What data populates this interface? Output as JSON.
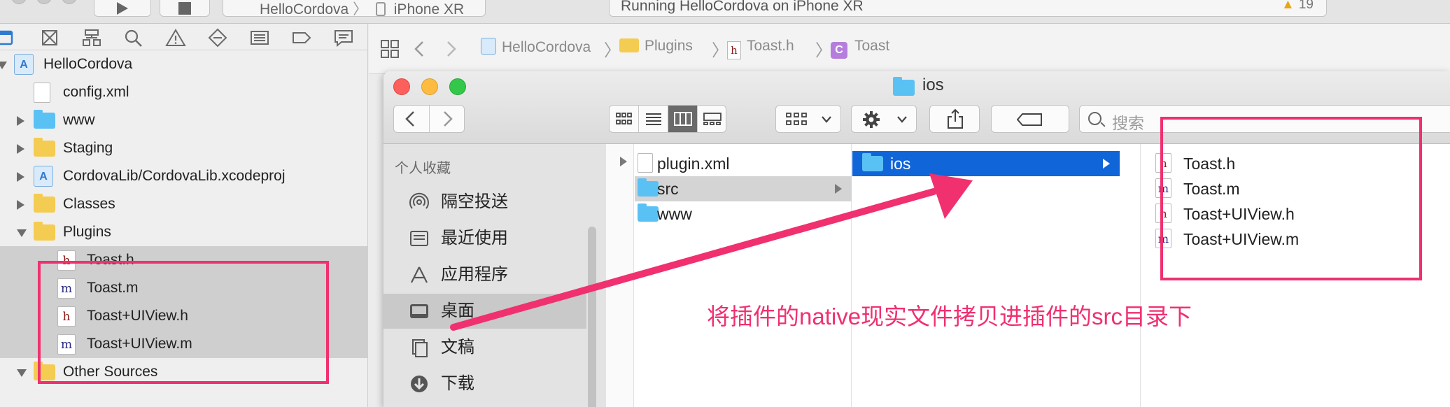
{
  "toolbar": {
    "scheme_app": "HelloCordova",
    "scheme_device": "iPhone XR",
    "status_text": "Running HelloCordova on iPhone XR",
    "warning_count": "19"
  },
  "navigator": {
    "tree": [
      {
        "label": "HelloCordova",
        "kind": "project",
        "disclosure": "down",
        "indent": 0
      },
      {
        "label": "config.xml",
        "kind": "file",
        "disclosure": "none",
        "indent": 1
      },
      {
        "label": "www",
        "kind": "folder-blue",
        "disclosure": "right",
        "indent": 1
      },
      {
        "label": "Staging",
        "kind": "folder-yellow",
        "disclosure": "right",
        "indent": 1
      },
      {
        "label": "CordovaLib/CordovaLib.xcodeproj",
        "kind": "project",
        "disclosure": "right",
        "indent": 1
      },
      {
        "label": "Classes",
        "kind": "folder-yellow",
        "disclosure": "right",
        "indent": 1
      },
      {
        "label": "Plugins",
        "kind": "folder-yellow",
        "disclosure": "down",
        "indent": 1
      },
      {
        "label": "Toast.h",
        "kind": "h",
        "disclosure": "none",
        "indent": 2,
        "selected": true
      },
      {
        "label": "Toast.m",
        "kind": "m",
        "disclosure": "none",
        "indent": 2,
        "selected": true
      },
      {
        "label": "Toast+UIView.h",
        "kind": "h",
        "disclosure": "none",
        "indent": 2,
        "selected": true
      },
      {
        "label": "Toast+UIView.m",
        "kind": "m",
        "disclosure": "none",
        "indent": 2,
        "selected": true
      },
      {
        "label": "Other Sources",
        "kind": "folder-yellow",
        "disclosure": "down",
        "indent": 1
      }
    ]
  },
  "jumpbar": {
    "crumbs": [
      "HelloCordova",
      "Plugins",
      "Toast.h",
      "Toast"
    ]
  },
  "finder": {
    "title": "ios",
    "search_placeholder": "搜索",
    "sidebar_heading": "个人收藏",
    "sidebar_items": [
      {
        "label": "隔空投送",
        "icon": "airdrop-icon"
      },
      {
        "label": "最近使用",
        "icon": "recents-icon"
      },
      {
        "label": "应用程序",
        "icon": "applications-icon"
      },
      {
        "label": "桌面",
        "icon": "desktop-icon",
        "selected": true
      },
      {
        "label": "文稿",
        "icon": "documents-icon"
      },
      {
        "label": "下载",
        "icon": "downloads-icon"
      }
    ],
    "col1": [
      {
        "label": "plugin.xml",
        "kind": "file"
      },
      {
        "label": "src",
        "kind": "folder",
        "state": "grey"
      },
      {
        "label": "www",
        "kind": "folder"
      }
    ],
    "col2": [
      {
        "label": "ios",
        "kind": "folder",
        "state": "blue"
      }
    ],
    "col3": [
      {
        "label": "Toast.h",
        "kind": "h"
      },
      {
        "label": "Toast.m",
        "kind": "m"
      },
      {
        "label": "Toast+UIView.h",
        "kind": "h"
      },
      {
        "label": "Toast+UIView.m",
        "kind": "m"
      }
    ]
  },
  "annotation": {
    "text": "将插件的native现实文件拷贝进插件的src目录下",
    "color": "#f0306f"
  }
}
